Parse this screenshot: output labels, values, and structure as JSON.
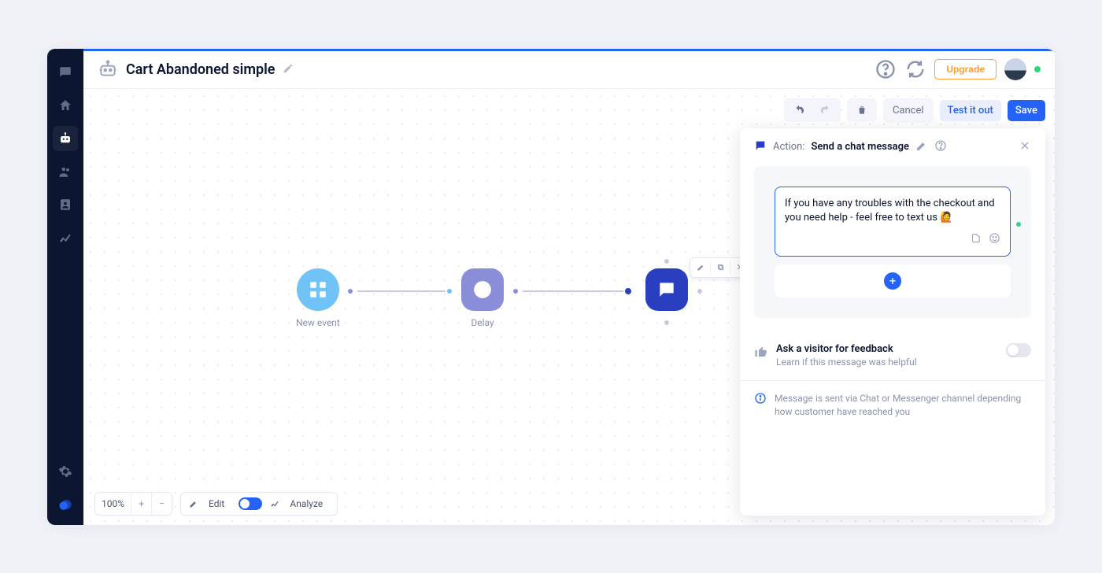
{
  "page": {
    "title": "Cart Abandoned simple",
    "upgrade_label": "Upgrade"
  },
  "actions": {
    "cancel": "Cancel",
    "test": "Test it out",
    "save": "Save"
  },
  "flow": {
    "node1_label": "New event",
    "node2_label": "Delay"
  },
  "zoom": {
    "level": "100%"
  },
  "mode": {
    "edit": "Edit",
    "analyze": "Analyze"
  },
  "panel": {
    "prefix": "Action:",
    "title": "Send a chat message",
    "message_text": "If you have any troubles with the checkout and you need help - feel free to text us 🙋",
    "feedback_title": "Ask a visitor for feedback",
    "feedback_sub": "Learn if this message was helpful",
    "info_text": "Message is sent via Chat or Messenger channel depending how customer have reached you"
  }
}
